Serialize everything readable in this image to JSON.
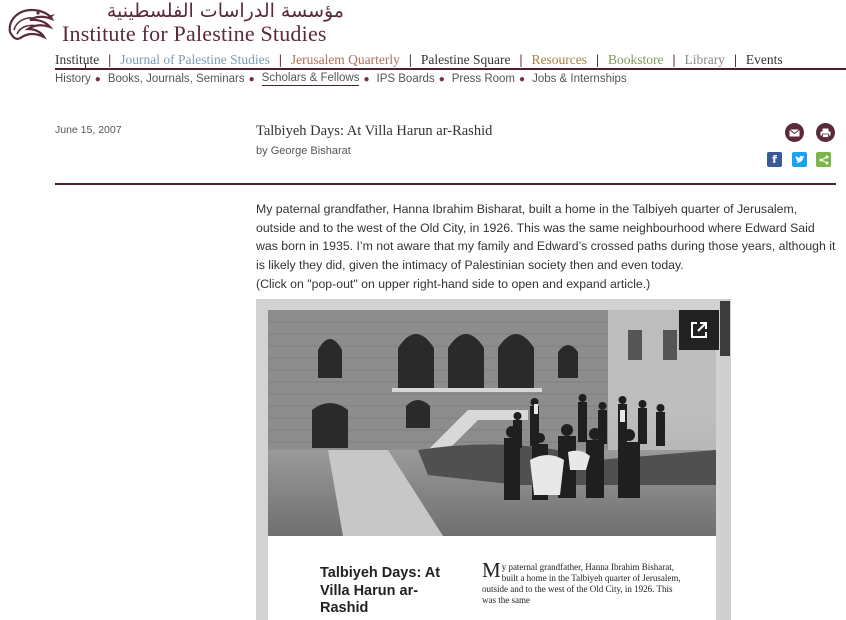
{
  "logo": {
    "arabic": "مؤسسة الدراسات الفلسطينية",
    "english": "Institute for Palestine Studies"
  },
  "main_nav": [
    {
      "label": "Institute",
      "color": "#333333"
    },
    {
      "label": "Journal of Palestine Studies",
      "color": "#7a9bb8"
    },
    {
      "label": "Jerusalem Quarterly",
      "color": "#b0705a"
    },
    {
      "label": "Palestine Square",
      "color": "#333333"
    },
    {
      "label": "Resources",
      "color": "#a8833c"
    },
    {
      "label": "Bookstore",
      "color": "#7e9a5a"
    },
    {
      "label": "Library",
      "color": "#8a8a8a"
    },
    {
      "label": "Events",
      "color": "#333333"
    }
  ],
  "sub_nav": [
    {
      "label": "History"
    },
    {
      "label": "Books, Journals, Seminars"
    },
    {
      "label": "Scholars & Fellows"
    },
    {
      "label": "IPS Boards"
    },
    {
      "label": "Press Room"
    },
    {
      "label": "Jobs & Internships"
    }
  ],
  "article": {
    "date": "June 15, 2007",
    "title": "Talbiyeh Days: At Villa Harun ar-Rashid",
    "byline_prefix": "by",
    "author": "George Bisharat",
    "body": "My paternal grandfather, Hanna Ibrahim Bisharat, built a home in the Talbiyeh quarter of Jerusalem, outside and to the west of the Old City, in 1926. This was the same neighbourhood where Edward Said was born in 1935. I’m not aware that my family and Edward’s crossed paths during those years, although it is likely they did, given the intimacy of Palestinian society then and even today.",
    "note": "(Click on \"pop-out\" on upper right-hand side to open and expand article.)"
  },
  "icons": {
    "email": "email-icon",
    "print": "print-icon",
    "facebook": "f",
    "twitter": "t",
    "share": "<",
    "brand_color": "#5a2a3a",
    "facebook_color": "#3b5998",
    "twitter_color": "#1da1f2",
    "share_color": "#7ab648"
  },
  "document": {
    "title": "Talbiyeh Days: At Villa Harun ar-Rashid",
    "dropcap": "M",
    "text": "y paternal grandfather, Hanna Ibrahim Bisharat, built a home in the Talbiyeh quarter of Jerusalem, outside and to the west of the Old City, in 1926. This was the same"
  }
}
